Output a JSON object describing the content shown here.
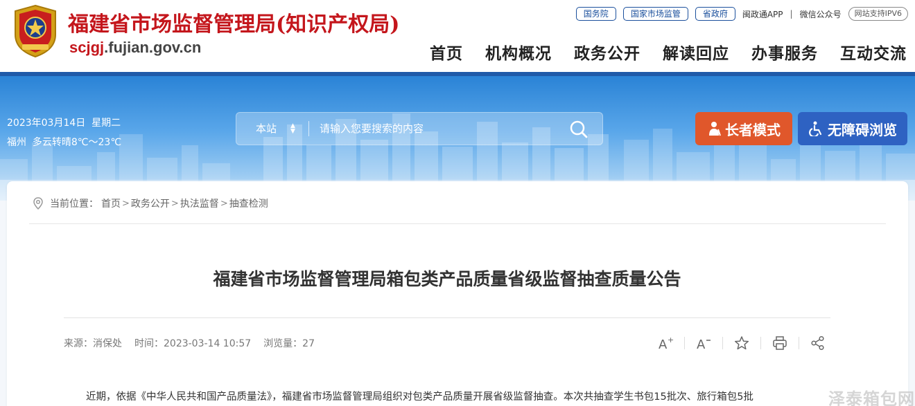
{
  "header": {
    "site_title": "福建省市场监督管理局(知识产权局)",
    "domain_prefix": "scjgj",
    "domain_suffix": ".fujian.gov.cn",
    "top_links": {
      "state_council": "国务院",
      "samr": "国家市场监管",
      "provincial_gov": "省政府",
      "app": "闽政通APP",
      "separator": "|",
      "wechat": "微信公众号",
      "ipv6": "网站支持IPV6"
    },
    "nav": [
      "首页",
      "机构概况",
      "政务公开",
      "解读回应",
      "办事服务",
      "互动交流"
    ]
  },
  "banner": {
    "date": "2023年03月14日  星期二",
    "weather": "福州  多云转晴8℃～23℃",
    "search": {
      "scope": "本站",
      "placeholder": "请输入您要搜索的内容"
    },
    "elder_mode": "长者模式",
    "accessibility": "无障碍浏览"
  },
  "breadcrumb": {
    "label": "当前位置：",
    "items": [
      "首页",
      "政务公开",
      "执法监督",
      "抽查检测"
    ],
    "separator": ">"
  },
  "article": {
    "title": "福建省市场监督管理局箱包类产品质量省级监督抽查质量公告",
    "source": "来源：消保处",
    "time": "时间：2023-03-14 10:57",
    "views": "浏览量：27",
    "body": "近期，依据《中华人民共和国产品质量法》，福建省市场监督管理局组织对包类产品质量开展省级监督抽查。本次共抽查学生书包15批次、旅行箱包5批"
  },
  "watermark": "泽泰箱包网",
  "colors": {
    "brand_red": "#c4161c",
    "brand_blue": "#1f5aa8",
    "elder_orange": "#e0572b",
    "access_blue": "#2e62c2"
  }
}
